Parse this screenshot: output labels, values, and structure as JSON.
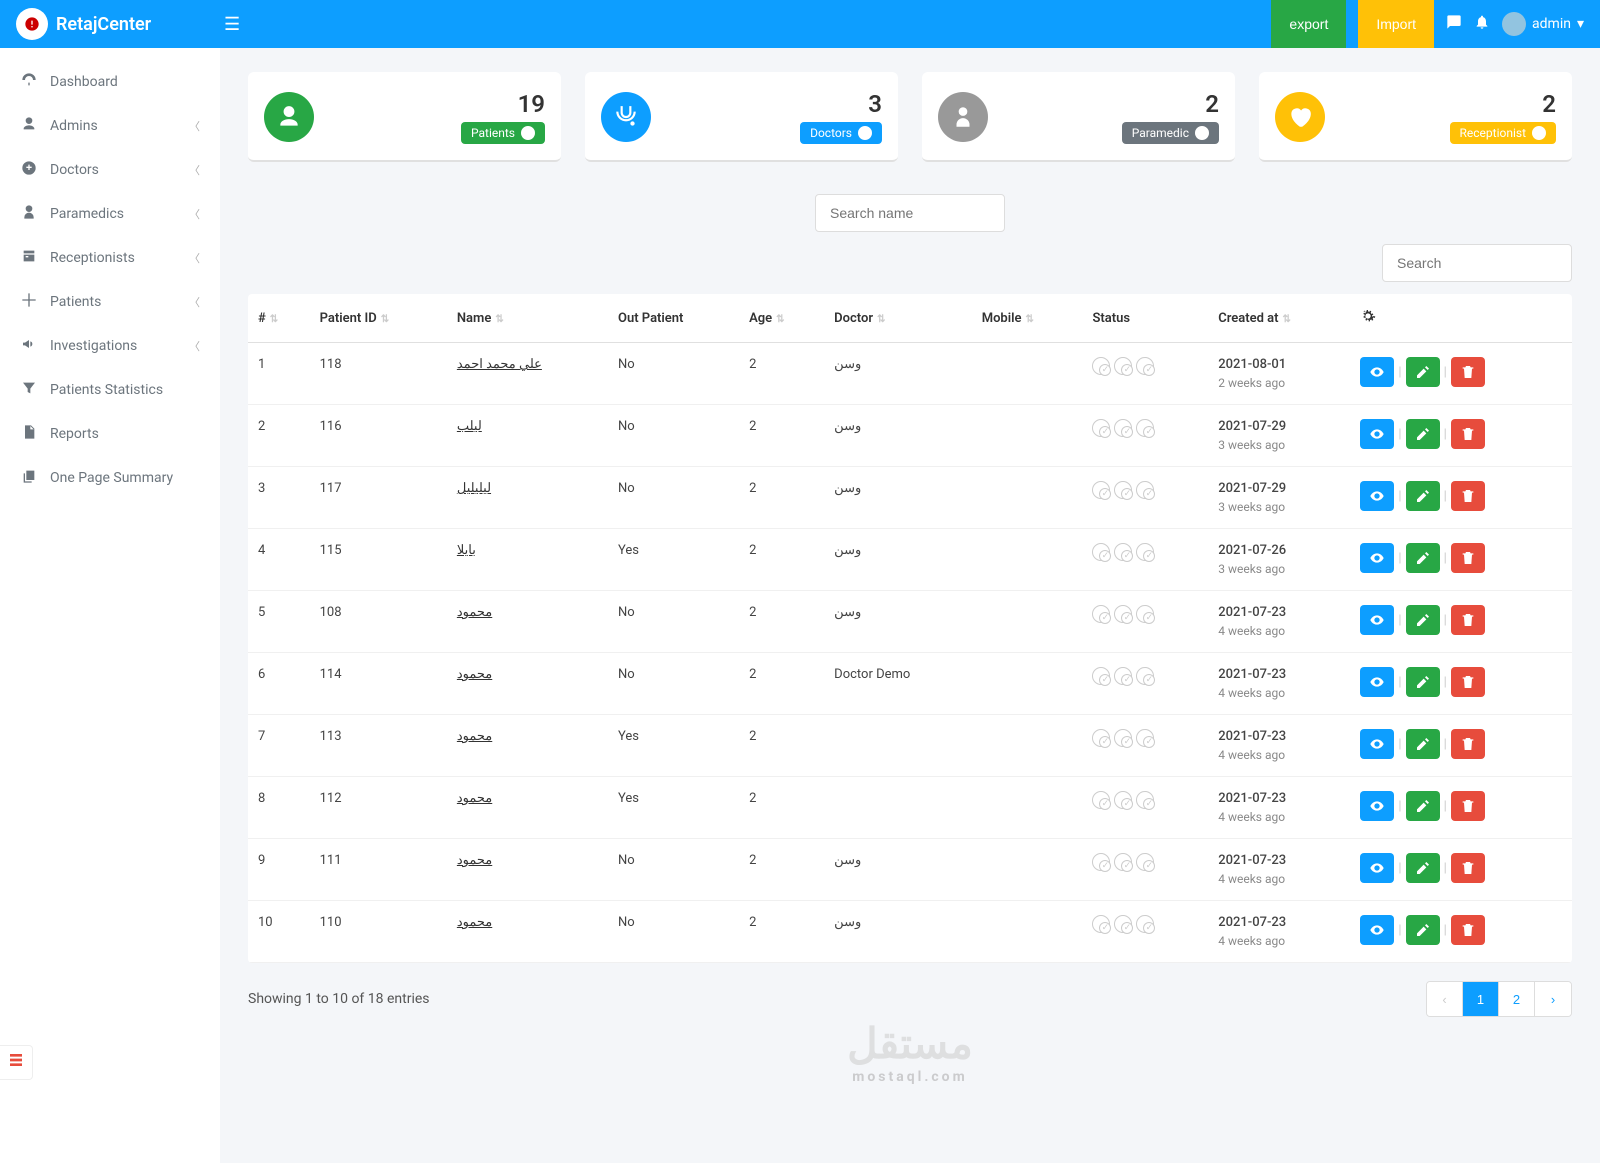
{
  "header": {
    "brand": "RetajCenter",
    "export": "export",
    "import": "Import",
    "user": "admin"
  },
  "sidebar": {
    "items": [
      {
        "label": "Dashboard",
        "icon": "dashboard",
        "expand": false
      },
      {
        "label": "Admins",
        "icon": "user",
        "expand": true
      },
      {
        "label": "Doctors",
        "icon": "doctor",
        "expand": true
      },
      {
        "label": "Paramedics",
        "icon": "paramedic",
        "expand": true
      },
      {
        "label": "Receptionists",
        "icon": "receptionist",
        "expand": true
      },
      {
        "label": "Patients",
        "icon": "patients",
        "expand": true
      },
      {
        "label": "Investigations",
        "icon": "bullhorn",
        "expand": true
      },
      {
        "label": "Patients Statistics",
        "icon": "filter",
        "expand": false
      },
      {
        "label": "Reports",
        "icon": "file",
        "expand": false
      },
      {
        "label": "One Page Summary",
        "icon": "copy",
        "expand": false
      }
    ]
  },
  "stats": [
    {
      "count": "19",
      "label": "Patients",
      "color": "green",
      "icon": "user"
    },
    {
      "count": "3",
      "label": "Doctors",
      "color": "blue",
      "icon": "stethoscope"
    },
    {
      "count": "2",
      "label": "Paramedic",
      "color": "gray",
      "icon": "nurse"
    },
    {
      "count": "2",
      "label": "Receptionist",
      "color": "orange",
      "icon": "heart"
    }
  ],
  "search": {
    "placeholder": "Search name",
    "table_search": "Search"
  },
  "table": {
    "headers": [
      "#",
      "Patient ID",
      "Name",
      "Out Patient",
      "Age",
      "Doctor",
      "Mobile",
      "Status",
      "Created at",
      ""
    ],
    "rows": [
      {
        "idx": "1",
        "pid": "118",
        "name": "علي محمد احمد",
        "out": "No",
        "age": "2",
        "doctor": "وسن",
        "mobile": "",
        "date": "2021-08-01",
        "ago": "2 weeks ago"
      },
      {
        "idx": "2",
        "pid": "116",
        "name": "ليلب",
        "out": "No",
        "age": "2",
        "doctor": "وسن",
        "mobile": "",
        "date": "2021-07-29",
        "ago": "3 weeks ago"
      },
      {
        "idx": "3",
        "pid": "117",
        "name": "ليليليل",
        "out": "No",
        "age": "2",
        "doctor": "وسن",
        "mobile": "",
        "date": "2021-07-29",
        "ago": "3 weeks ago"
      },
      {
        "idx": "4",
        "pid": "115",
        "name": "بايلا",
        "out": "Yes",
        "age": "2",
        "doctor": "وسن",
        "mobile": "",
        "date": "2021-07-26",
        "ago": "3 weeks ago"
      },
      {
        "idx": "5",
        "pid": "108",
        "name": "محمود",
        "out": "No",
        "age": "2",
        "doctor": "وسن",
        "mobile": "",
        "date": "2021-07-23",
        "ago": "4 weeks ago"
      },
      {
        "idx": "6",
        "pid": "114",
        "name": "محمود",
        "out": "No",
        "age": "2",
        "doctor": "Doctor Demo",
        "mobile": "",
        "date": "2021-07-23",
        "ago": "4 weeks ago"
      },
      {
        "idx": "7",
        "pid": "113",
        "name": "محمود",
        "out": "Yes",
        "age": "2",
        "doctor": "",
        "mobile": "",
        "date": "2021-07-23",
        "ago": "4 weeks ago"
      },
      {
        "idx": "8",
        "pid": "112",
        "name": "محمود",
        "out": "Yes",
        "age": "2",
        "doctor": "",
        "mobile": "",
        "date": "2021-07-23",
        "ago": "4 weeks ago"
      },
      {
        "idx": "9",
        "pid": "111",
        "name": "محمود",
        "out": "No",
        "age": "2",
        "doctor": "وسن",
        "mobile": "",
        "date": "2021-07-23",
        "ago": "4 weeks ago"
      },
      {
        "idx": "10",
        "pid": "110",
        "name": "محمود",
        "out": "No",
        "age": "2",
        "doctor": "وسن",
        "mobile": "",
        "date": "2021-07-23",
        "ago": "4 weeks ago"
      }
    ],
    "footer": "Showing 1 to 10 of 18 entries",
    "pages": [
      "1",
      "2"
    ]
  },
  "watermark": {
    "main": "مستقل",
    "sub": "mostaql.com"
  }
}
